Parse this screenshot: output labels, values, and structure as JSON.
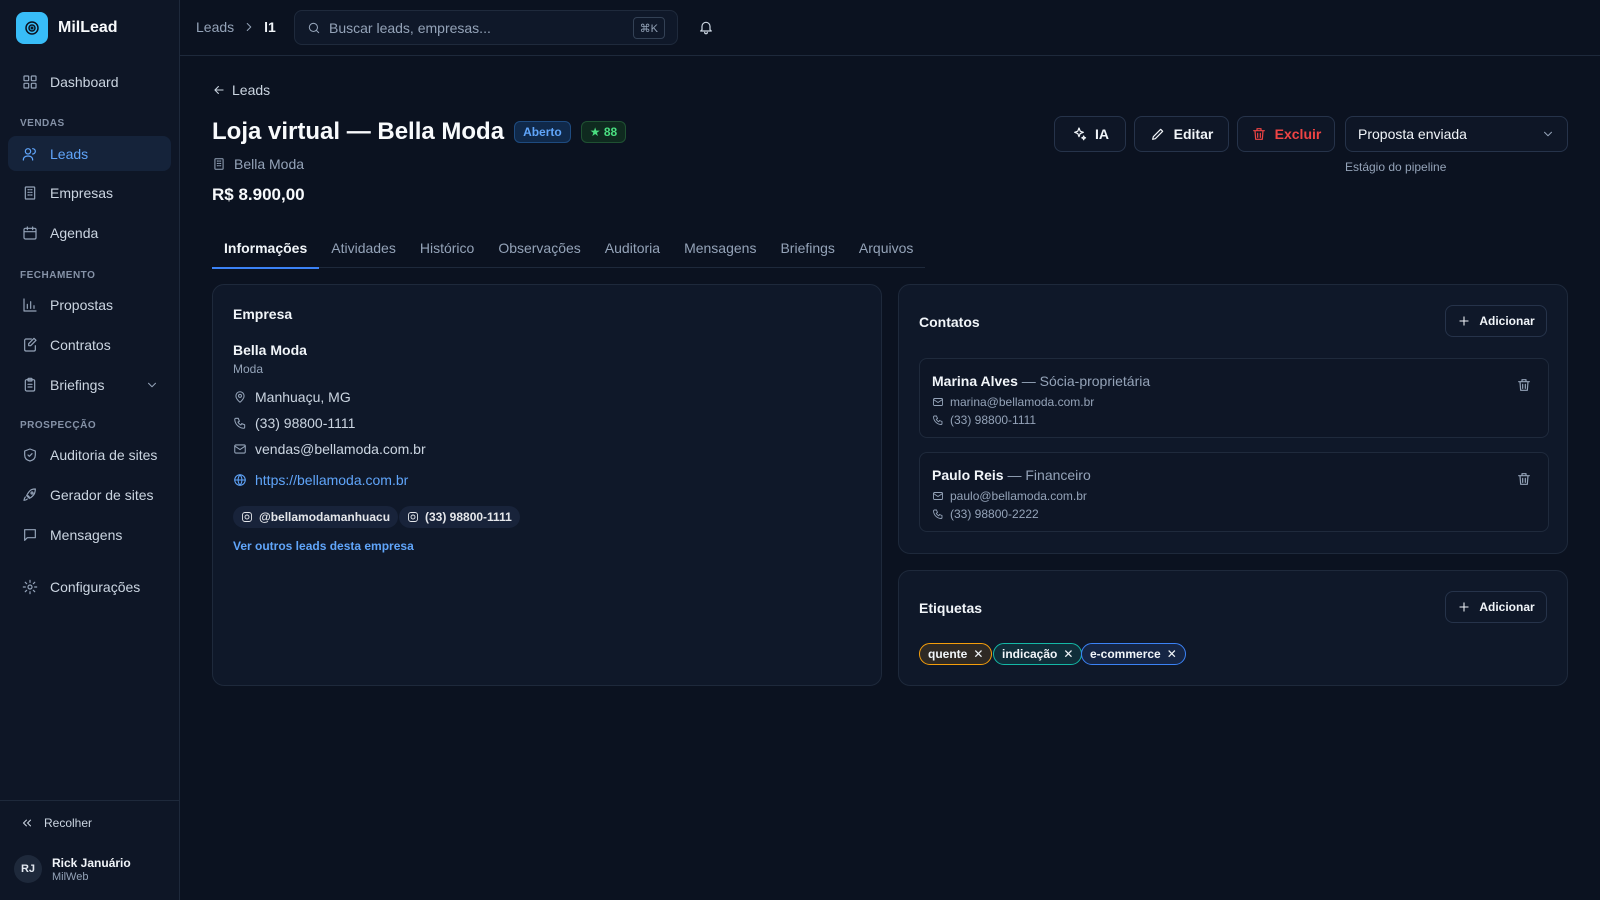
{
  "app": {
    "name": "MilLead"
  },
  "sidebar": {
    "sections": {
      "vendas": "VENDAS",
      "fechamento": "FECHAMENTO",
      "prospeccao": "PROSPECÇÃO"
    },
    "items": [
      {
        "label": "Dashboard",
        "icon": "grid-icon"
      },
      {
        "label": "Leads",
        "icon": "users-icon",
        "active": true
      },
      {
        "label": "Empresas",
        "icon": "building-icon"
      },
      {
        "label": "Agenda",
        "icon": "calendar-icon"
      },
      {
        "label": "Propostas",
        "icon": "bar-chart-icon"
      },
      {
        "label": "Contratos",
        "icon": "file-edit-icon"
      },
      {
        "label": "Briefings",
        "icon": "clipboard-icon"
      },
      {
        "label": "Auditoria de sites",
        "icon": "shield-icon"
      },
      {
        "label": "Gerador de sites",
        "icon": "rocket-icon"
      },
      {
        "label": "Mensagens",
        "icon": "message-icon"
      },
      {
        "label": "Configurações",
        "icon": "gear-icon"
      }
    ],
    "collapse_label": "Recolher",
    "user": {
      "initials": "RJ",
      "name": "Rick Januário",
      "org": "MilWeb"
    }
  },
  "topbar": {
    "breadcrumb": {
      "parent": "Leads",
      "current": "l1"
    },
    "search": {
      "placeholder": "Buscar leads, empresas...",
      "shortcut": "⌘K"
    }
  },
  "lead": {
    "back_label": "Leads",
    "title": "Loja virtual — Bella Moda",
    "status": "Aberto",
    "score": "★ 88",
    "company": "Bella Moda",
    "value": "R$ 8.900,00"
  },
  "actions": {
    "ai": "IA",
    "edit": "Editar",
    "delete": "Excluir",
    "stage": "Proposta enviada",
    "stage_hint": "Estágio do pipeline"
  },
  "tabs": [
    "Informações",
    "Atividades",
    "Histórico",
    "Observações",
    "Auditoria",
    "Mensagens",
    "Briefings",
    "Arquivos"
  ],
  "company_card": {
    "title": "Empresa",
    "name": "Bella Moda",
    "sector": "Moda",
    "location": "Manhuaçu, MG",
    "phone": "(33) 98800-1111",
    "email": "vendas@bellamoda.com.br",
    "website": "https://bellamoda.com.br",
    "instagram": "@bellamodamanhuacu",
    "whatsapp": "(33) 98800-1111",
    "more_link": "Ver outros leads desta empresa"
  },
  "contacts_card": {
    "title": "Contatos",
    "add_label": "Adicionar",
    "contacts": [
      {
        "name": "Marina Alves",
        "role": "— Sócia-proprietária",
        "email": "marina@bellamoda.com.br",
        "phone": "(33) 98800-1111"
      },
      {
        "name": "Paulo Reis",
        "role": "— Financeiro",
        "email": "paulo@bellamoda.com.br",
        "phone": "(33) 98800-2222"
      }
    ]
  },
  "tags_card": {
    "title": "Etiquetas",
    "add_label": "Adicionar",
    "tags": [
      {
        "label": "quente",
        "color": "#f59e0b"
      },
      {
        "label": "indicação",
        "color": "#14b8a6"
      },
      {
        "label": "e-commerce",
        "color": "#3b82f6"
      }
    ]
  },
  "colors": {
    "accent": "#3b82f6",
    "danger": "#ef4444",
    "background": "#0b1220"
  }
}
